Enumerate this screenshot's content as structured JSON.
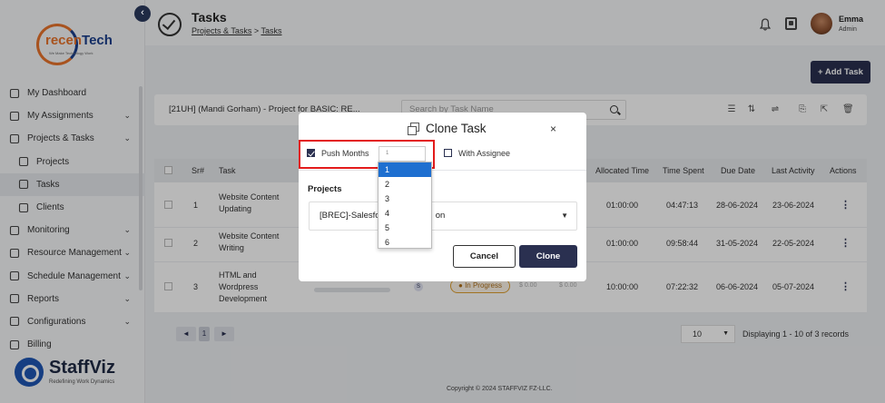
{
  "brand": {
    "name_a": "recen",
    "name_b": "Tech",
    "tagline": "We Make Technology Work"
  },
  "sidebar": {
    "items": [
      {
        "label": "My Dashboard",
        "icon": "dashboard-icon",
        "sub": false,
        "chevron": false
      },
      {
        "label": "My Assignments",
        "icon": "clipboard-icon",
        "sub": false,
        "chevron": true
      },
      {
        "label": "Projects & Tasks",
        "icon": "clipboard-check-icon",
        "sub": false,
        "chevron": true
      },
      {
        "label": "Projects",
        "icon": "document-icon",
        "sub": true,
        "chevron": false
      },
      {
        "label": "Tasks",
        "icon": "check-circle-icon",
        "sub": true,
        "chevron": false,
        "active": true
      },
      {
        "label": "Clients",
        "icon": "users-icon",
        "sub": true,
        "chevron": false
      },
      {
        "label": "Monitoring",
        "icon": "monitor-icon",
        "sub": false,
        "chevron": true
      },
      {
        "label": "Resource Management",
        "icon": "people-icon",
        "sub": false,
        "chevron": true
      },
      {
        "label": "Schedule Management",
        "icon": "calendar-icon",
        "sub": false,
        "chevron": true
      },
      {
        "label": "Reports",
        "icon": "report-icon",
        "sub": false,
        "chevron": true
      },
      {
        "label": "Configurations",
        "icon": "gear-icon",
        "sub": false,
        "chevron": true
      },
      {
        "label": "Billing",
        "icon": "billing-icon",
        "sub": false,
        "chevron": false
      }
    ]
  },
  "footer_brand": {
    "name": "StaffViz",
    "tagline": "Redefining Work Dynamics"
  },
  "header": {
    "title": "Tasks",
    "breadcrumb_1": "Projects & Tasks",
    "breadcrumb_sep": ">",
    "breadcrumb_2": "Tasks",
    "user_name": "Emma",
    "user_role": "Admin"
  },
  "add_task_label": "+ Add Task",
  "filters": {
    "project_value": "[21UH] (Mandi Gorham) - Project for BASIC: RE...",
    "search_placeholder": "Search by Task Name"
  },
  "table": {
    "headers": [
      "Sr#",
      "Task",
      "Allocated Time",
      "Time Spent",
      "Due Date",
      "Last Activity",
      "Actions"
    ],
    "rows": [
      {
        "sr": "1",
        "task_1": "Website Content",
        "task_2": "Updating",
        "task_3": "",
        "allocated": "01:00:00",
        "spent": "04:47:13",
        "due": "28-06-2024",
        "last": "23-06-2024"
      },
      {
        "sr": "2",
        "task_1": "Website Content",
        "task_2": "Writing",
        "task_3": "",
        "allocated": "01:00:00",
        "spent": "09:58:44",
        "due": "31-05-2024",
        "last": "22-05-2024"
      },
      {
        "sr": "3",
        "task_1": "HTML and",
        "task_2": "Wordpress",
        "task_3": "Development",
        "allocated": "10:00:00",
        "spent": "07:22:32",
        "due": "06-06-2024",
        "last": "05-07-2024",
        "status": "In Progress",
        "money_1": "$ 0.00",
        "money_2": "$ 0.00",
        "avatar_letter": "S"
      }
    ]
  },
  "pagination": {
    "prev": "◄",
    "page": "1",
    "next": "►",
    "page_size": "10",
    "displaying": "Displaying 1 - 10 of 3 records"
  },
  "copyright": "Copyright © 2024 STAFFVIZ FZ-LLC.",
  "modal": {
    "title": "Clone Task",
    "close": "×",
    "push_months_label": "Push Months",
    "push_months_checked": true,
    "months_value": "1",
    "with_assignee_label": "With Assignee",
    "with_assignee_checked": false,
    "projects_label": "Projects",
    "project_value_a": "[BREC]-Salesfor",
    "project_value_b": "on",
    "cancel_label": "Cancel",
    "clone_label": "Clone"
  },
  "months_dropdown": {
    "options": [
      "1",
      "2",
      "3",
      "4",
      "5",
      "6"
    ],
    "selected": "1"
  },
  "colors": {
    "primary": "#2a3050",
    "highlight": "#e31b1b",
    "selected_option": "#1e6fd0",
    "status_in_progress": "#e0a030"
  }
}
